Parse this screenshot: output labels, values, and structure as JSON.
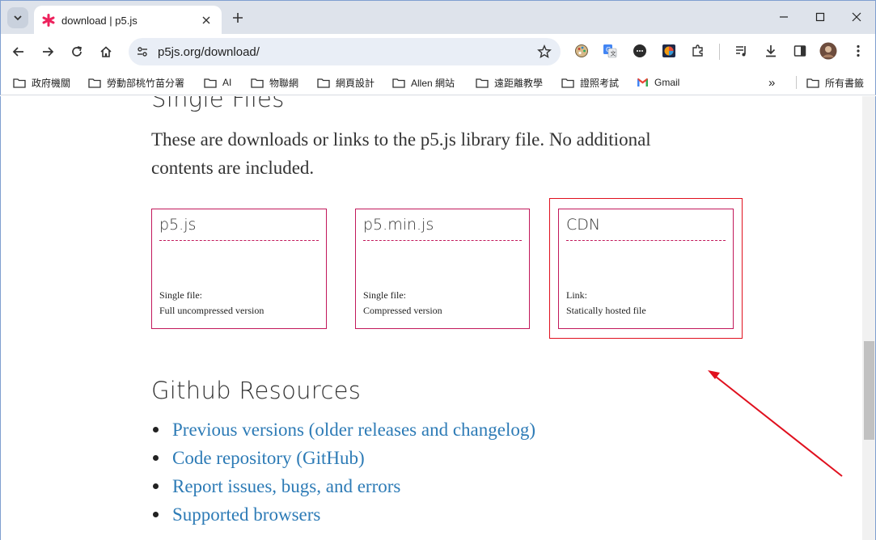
{
  "browser": {
    "tab": {
      "title": "download | p5.js"
    },
    "omnibox": {
      "url": "p5js.org/download/"
    },
    "bookmarks": [
      {
        "label": "政府機關"
      },
      {
        "label": "勞動部桃竹苗分署"
      },
      {
        "label": "AI"
      },
      {
        "label": "物聯網"
      },
      {
        "label": "網頁設計"
      },
      {
        "label": "Allen 網站"
      },
      {
        "label": "遠距離教學"
      },
      {
        "label": "證照考試"
      },
      {
        "label": "Gmail"
      }
    ],
    "bookmarks_overflow": "»",
    "other_bookmarks": "所有書籤"
  },
  "page": {
    "single_files": {
      "heading": "Single Files",
      "intro": "These are downloads or links to the p5.js library file. No additional contents are included.",
      "cards": [
        {
          "title": "p5.js",
          "line1": "Single file:",
          "line2": "Full uncompressed version"
        },
        {
          "title": "p5.min.js",
          "line1": "Single file:",
          "line2": "Compressed version"
        },
        {
          "title": "CDN",
          "line1": "Link:",
          "line2": "Statically hosted file"
        }
      ]
    },
    "github": {
      "heading": "Github Resources",
      "links": [
        "Previous versions (older releases and changelog)",
        "Code repository (GitHub)",
        "Report issues, bugs, and errors",
        "Supported browsers"
      ]
    }
  },
  "colors": {
    "card_border": "#c2185b",
    "link": "#2d7bb6",
    "annotation": "#e0101e",
    "tab_strip": "#dee3eb"
  }
}
